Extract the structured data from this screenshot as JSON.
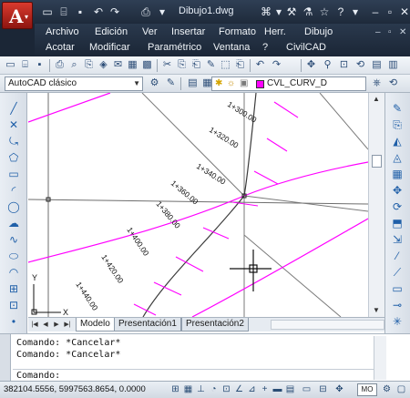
{
  "title_bar": {
    "document_title": "Dibujo1.dwg",
    "quick_access_icons": [
      "new-icon",
      "open-icon",
      "save-icon",
      "undo-icon",
      "redo-icon",
      "plot-icon",
      "dropdown-icon"
    ],
    "right_icons": [
      "binoculars-icon",
      "dropdown-icon",
      "tools-icon",
      "network-icon",
      "star-icon",
      "help-icon",
      "dropdown-icon"
    ],
    "window_controls": [
      "minimize-icon",
      "restore-icon",
      "close-icon"
    ]
  },
  "app_button": {
    "glyph": "A",
    "icon": "autocad-logo-icon",
    "drop": "▾"
  },
  "menu": {
    "row1": [
      "Archivo",
      "Edición",
      "Ver",
      "Insertar",
      "Formato",
      "Herr.",
      "Dibujo"
    ],
    "row2": [
      "Acotar",
      "Modificar",
      "Paramétrico",
      "Ventana",
      "?",
      "CivilCAD"
    ]
  },
  "workspace": {
    "selected": "AutoCAD clásico"
  },
  "layer": {
    "name": "CVL_CURV_D",
    "color": "#ff00ff"
  },
  "drawing": {
    "line_color": "#ff00ff",
    "station_labels": [
      "1+300.00",
      "1+320.00",
      "1+340.00",
      "1+360.00",
      "1+380.00",
      "1+400.00",
      "1+420.00",
      "1+440.00"
    ],
    "ucs": {
      "x_label": "X",
      "y_label": "Y"
    }
  },
  "layout_tabs": [
    "Modelo",
    "Presentación1",
    "Presentación2"
  ],
  "command_line": {
    "history": [
      "Comando: *Cancelar*",
      "Comando: *Cancelar*"
    ],
    "prompt": "Comando:"
  },
  "status_bar": {
    "coordinates": "382104.5556, 5997563.8654, 0.0000",
    "mode": "MO"
  }
}
